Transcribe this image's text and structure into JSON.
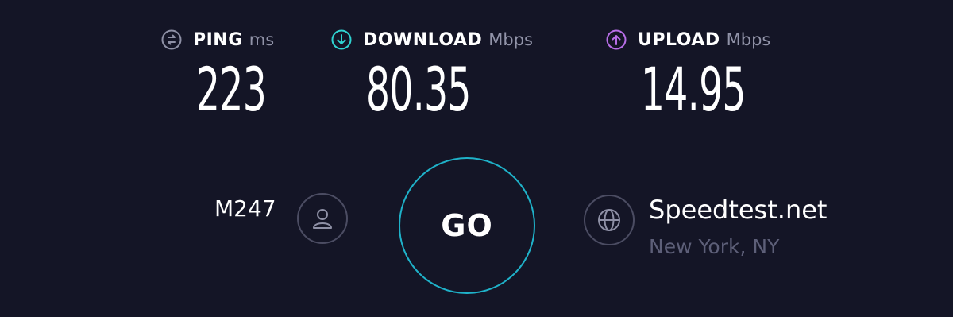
{
  "metrics": {
    "ping": {
      "label": "PING",
      "unit": "ms",
      "value": "223",
      "icon": "ping-icon",
      "color": "#8e90a5"
    },
    "download": {
      "label": "DOWNLOAD",
      "unit": "Mbps",
      "value": "80.35",
      "icon": "download-icon",
      "color": "#2fd3d1"
    },
    "upload": {
      "label": "UPLOAD",
      "unit": "Mbps",
      "value": "14.95",
      "icon": "upload-icon",
      "color": "#b86ee8"
    }
  },
  "provider": {
    "name": "M247",
    "icon": "user-icon"
  },
  "go_button": {
    "label": "GO",
    "ring_color": "#1fb2c9"
  },
  "server": {
    "name": "Speedtest.net",
    "location": "New York, NY",
    "icon": "globe-icon"
  },
  "colors": {
    "background": "#141526",
    "muted_text": "#9193a8",
    "dim_text": "#5d5f78",
    "ring": "#4b4c62"
  }
}
